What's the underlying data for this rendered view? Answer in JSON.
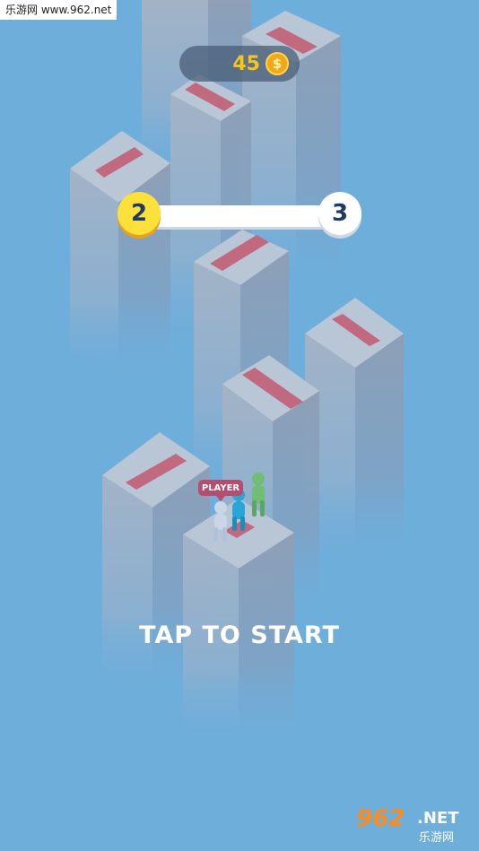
{
  "watermark": {
    "site": "乐游网 www.962.net",
    "logo_number": "962",
    "logo_suffix": ".NET",
    "logo_chinese": "乐游网"
  },
  "hud": {
    "coins": "45",
    "coin_symbol": "$",
    "coin_icon": "coin-icon"
  },
  "level": {
    "current": "2",
    "next": "3",
    "progress_fraction": 0.0
  },
  "player": {
    "tag": "PLAYER"
  },
  "prompt": {
    "tap_to_start": "TAP TO START"
  },
  "colors": {
    "sky": "#6eaedb",
    "pillar_top": "#b9c6d6",
    "pillar_left": "#a2b1c4",
    "pillar_right": "#8e9fb6",
    "stripe": "#c0697f",
    "coin": "#f5c518",
    "level_badge": "#fde03a"
  }
}
